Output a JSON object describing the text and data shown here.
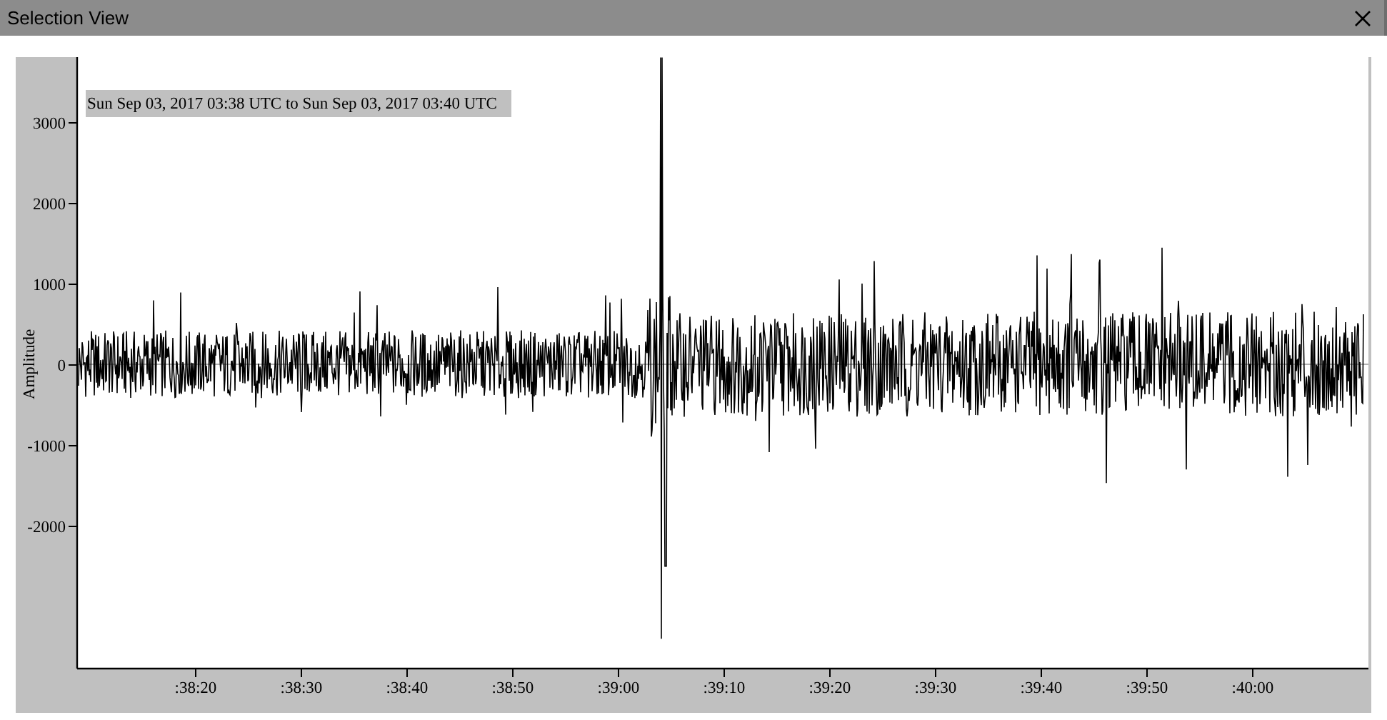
{
  "window": {
    "title": "Selection View"
  },
  "plot": {
    "time_range": "Sun Sep 03, 2017 03:38 UTC to Sun Sep 03, 2017 03:40 UTC",
    "ylabel": "Amplitude",
    "yticks": [
      "3000",
      "2000",
      "1000",
      "0",
      "-1000",
      "-2000"
    ],
    "xticks": [
      ":38:20",
      ":38:30",
      ":38:40",
      ":38:50",
      ":39:00",
      ":39:10",
      ":39:20",
      ":39:30",
      ":39:40",
      ":39:50",
      ":40:00"
    ]
  }
}
